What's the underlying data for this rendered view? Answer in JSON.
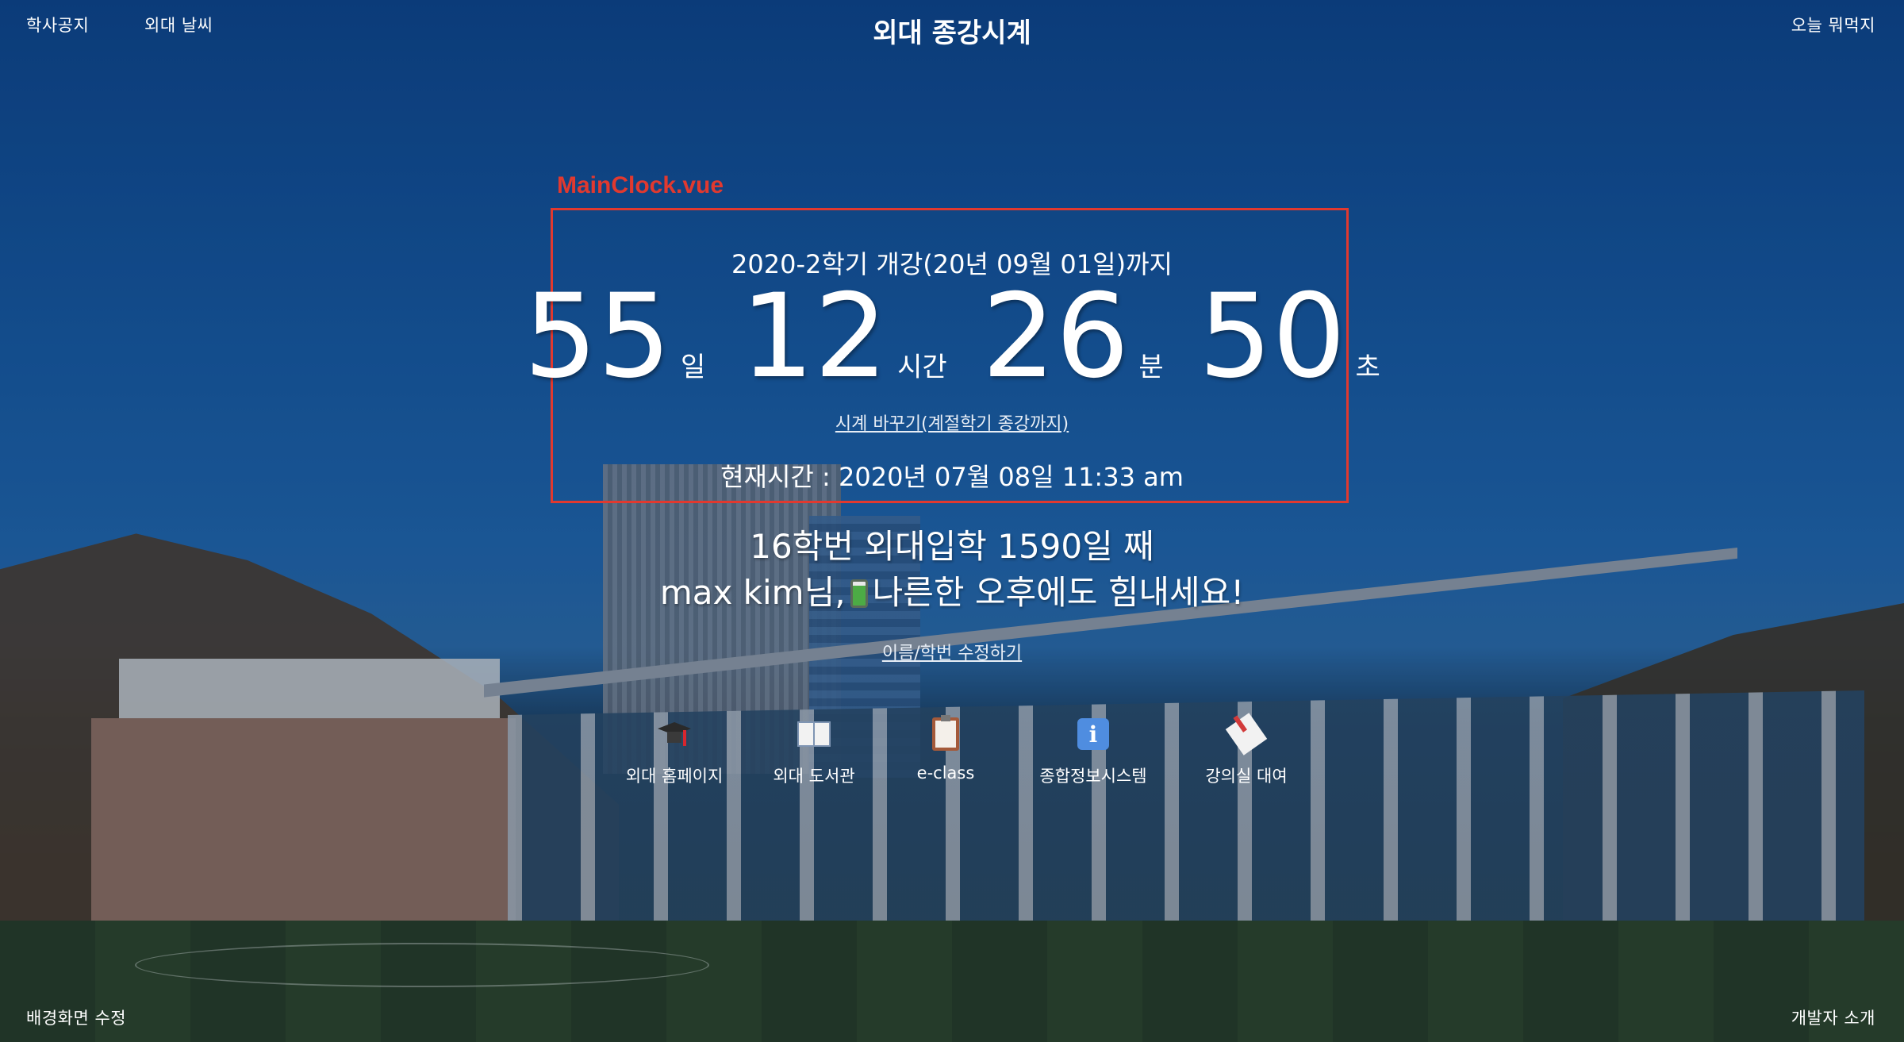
{
  "header": {
    "title": "외대 종강시계",
    "left_links": [
      "학사공지",
      "외대 날씨"
    ],
    "right_link": "오늘 뭐먹지"
  },
  "annotation": {
    "label": "MainClock.vue",
    "color": "#e1392f"
  },
  "clock": {
    "heading": "2020-2학기 개강(20년 09월 01일)까지",
    "countdown": [
      {
        "value": "55",
        "unit": "일"
      },
      {
        "value": "12",
        "unit": "시간"
      },
      {
        "value": "26",
        "unit": "분"
      },
      {
        "value": "50",
        "unit": "초"
      }
    ],
    "switch_link": "시계 바꾸기(계절학기 종강까지)",
    "current_time": "현재시간 : 2020년 07월 08일 11:33 am"
  },
  "greeting": {
    "line1": "16학번 외대입학 1590일 째",
    "line2_prefix": "max kim님,",
    "line2_icon": "battery-icon",
    "line2_suffix": "나른한 오후에도 힘내세요!",
    "edit_link": "이름/학번 수정하기"
  },
  "quick_links": [
    {
      "label": "외대 홈페이지",
      "icon": "graduation-cap-icon"
    },
    {
      "label": "외대 도서관",
      "icon": "open-book-icon"
    },
    {
      "label": "e-class",
      "icon": "clipboard-icon"
    },
    {
      "label": "종합정보시스템",
      "icon": "info-icon"
    },
    {
      "label": "강의실 대여",
      "icon": "memo-icon"
    }
  ],
  "footer": {
    "left_link": "배경화면 수정",
    "right_link": "개발자 소개"
  }
}
